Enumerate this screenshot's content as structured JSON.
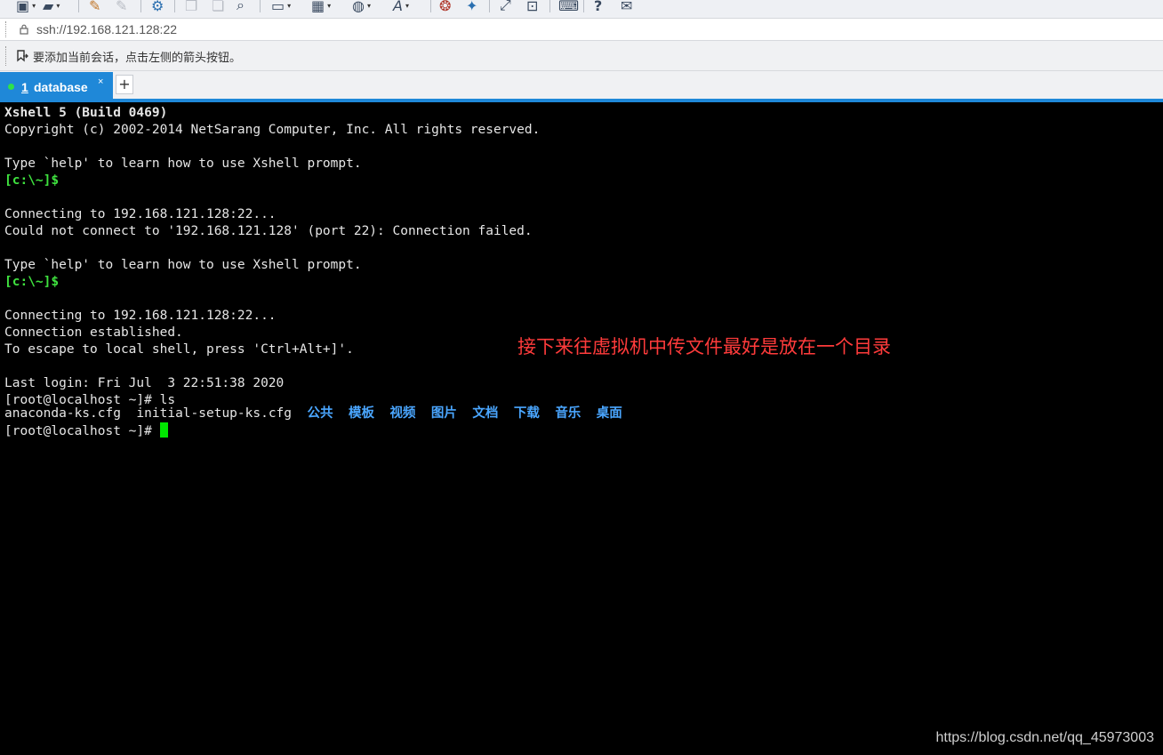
{
  "toolbar": {
    "items": [
      {
        "name": "new-session-icon",
        "glyph": "▣"
      },
      {
        "name": "open-folder-icon",
        "glyph": "▰"
      },
      {
        "name": "pen-icon",
        "glyph": "✎"
      },
      {
        "name": "pen-disabled-icon",
        "glyph": "✎"
      },
      {
        "name": "properties-icon",
        "glyph": "⚙"
      },
      {
        "name": "copy-icon",
        "glyph": "❐"
      },
      {
        "name": "paste-icon",
        "glyph": "❏"
      },
      {
        "name": "find-icon",
        "glyph": "⌕"
      },
      {
        "name": "screen-icon",
        "glyph": "▭"
      },
      {
        "name": "layout-icon",
        "glyph": "▦"
      },
      {
        "name": "globe-icon",
        "glyph": "◍"
      },
      {
        "name": "font-icon",
        "glyph": "A"
      },
      {
        "name": "xftp-icon",
        "glyph": "❂"
      },
      {
        "name": "xagent-icon",
        "glyph": "✦"
      },
      {
        "name": "fullscreen-icon",
        "glyph": "⤢"
      },
      {
        "name": "lock-screen-icon",
        "glyph": "⊡"
      },
      {
        "name": "keyboard-icon",
        "glyph": "⌨"
      },
      {
        "name": "help-icon",
        "glyph": "?"
      },
      {
        "name": "chat-icon",
        "glyph": "✉"
      }
    ]
  },
  "address": {
    "url": "ssh://192.168.121.128:22"
  },
  "info_bar": {
    "text": "要添加当前会话，点击左侧的箭头按钮。"
  },
  "tabs": {
    "active": {
      "number": "1",
      "title": "database",
      "close": "×"
    },
    "add": "+"
  },
  "terminal": {
    "lines": [
      {
        "text": "Xshell 5 (Build 0469)",
        "style": "bold"
      },
      {
        "text": "Copyright (c) 2002-2014 NetSarang Computer, Inc. All rights reserved.",
        "style": "normal"
      },
      {
        "text": "",
        "style": "normal"
      },
      {
        "text": "Type `help' to learn how to use Xshell prompt.",
        "style": "normal"
      },
      {
        "text": "[c:\\~]$",
        "style": "green"
      },
      {
        "text": "",
        "style": "normal"
      },
      {
        "text": "Connecting to 192.168.121.128:22...",
        "style": "normal"
      },
      {
        "text": "Could not connect to '192.168.121.128' (port 22): Connection failed.",
        "style": "normal"
      },
      {
        "text": "",
        "style": "normal"
      },
      {
        "text": "Type `help' to learn how to use Xshell prompt.",
        "style": "normal"
      },
      {
        "text": "[c:\\~]$",
        "style": "green"
      },
      {
        "text": "",
        "style": "normal"
      },
      {
        "text": "Connecting to 192.168.121.128:22...",
        "style": "normal"
      },
      {
        "text": "Connection established.",
        "style": "normal"
      },
      {
        "text": "To escape to local shell, press 'Ctrl+Alt+]'.",
        "style": "normal"
      },
      {
        "text": "",
        "style": "normal"
      },
      {
        "text": "Last login: Fri Jul  3 22:51:38 2020",
        "style": "normal"
      },
      {
        "text": "[root@localhost ~]# ls",
        "style": "normal"
      }
    ],
    "ls_files": [
      "anaconda-ks.cfg",
      "initial-setup-ks.cfg"
    ],
    "ls_dirs": [
      "公共",
      "模板",
      "视频",
      "图片",
      "文档",
      "下载",
      "音乐",
      "桌面"
    ],
    "prompt": "[root@localhost ~]# "
  },
  "annotation": "接下来往虚拟机中传文件最好是放在一个目录",
  "watermark": "https://blog.csdn.net/qq_45973003"
}
